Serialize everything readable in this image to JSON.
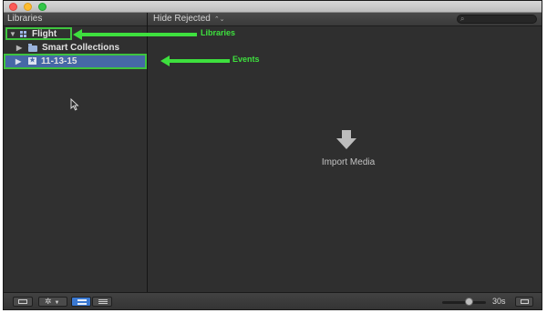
{
  "header": {
    "libraries_label": "Libraries",
    "filter_label": "Hide Rejected",
    "filter_arrows": "⌃⌄"
  },
  "sidebar": {
    "library_name": "Flight",
    "smart_collections": "Smart Collections",
    "event_name": "11-13-15"
  },
  "annotations": {
    "libraries": "Libraries",
    "events": "Events",
    "color": "#3ee03e"
  },
  "browser": {
    "import_label": "Import Media",
    "import_icon": "download-arrow-icon"
  },
  "bottom": {
    "zoom_label": "30s",
    "gear_glyph": "✲"
  },
  "colors": {
    "selection": "#4668a6",
    "highlight_outline": "#3ec43e"
  }
}
